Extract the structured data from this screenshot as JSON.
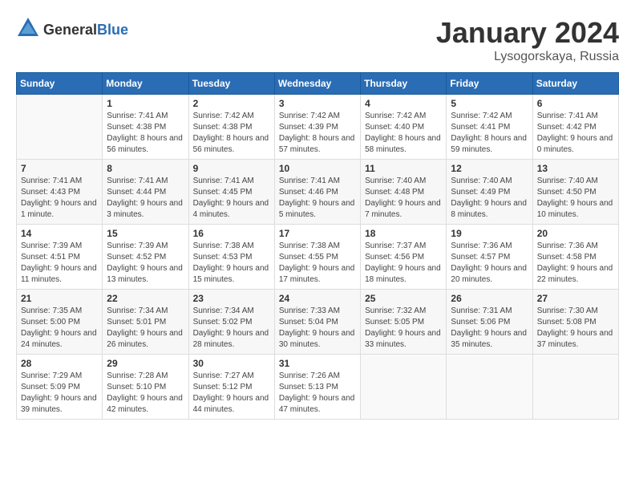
{
  "header": {
    "logo": {
      "general": "General",
      "blue": "Blue"
    },
    "month": "January 2024",
    "location": "Lysogorskaya, Russia"
  },
  "weekdays": [
    "Sunday",
    "Monday",
    "Tuesday",
    "Wednesday",
    "Thursday",
    "Friday",
    "Saturday"
  ],
  "weeks": [
    [
      {
        "day": "",
        "sunrise": "",
        "sunset": "",
        "daylight": ""
      },
      {
        "day": "1",
        "sunrise": "Sunrise: 7:41 AM",
        "sunset": "Sunset: 4:38 PM",
        "daylight": "Daylight: 8 hours and 56 minutes."
      },
      {
        "day": "2",
        "sunrise": "Sunrise: 7:42 AM",
        "sunset": "Sunset: 4:38 PM",
        "daylight": "Daylight: 8 hours and 56 minutes."
      },
      {
        "day": "3",
        "sunrise": "Sunrise: 7:42 AM",
        "sunset": "Sunset: 4:39 PM",
        "daylight": "Daylight: 8 hours and 57 minutes."
      },
      {
        "day": "4",
        "sunrise": "Sunrise: 7:42 AM",
        "sunset": "Sunset: 4:40 PM",
        "daylight": "Daylight: 8 hours and 58 minutes."
      },
      {
        "day": "5",
        "sunrise": "Sunrise: 7:42 AM",
        "sunset": "Sunset: 4:41 PM",
        "daylight": "Daylight: 8 hours and 59 minutes."
      },
      {
        "day": "6",
        "sunrise": "Sunrise: 7:41 AM",
        "sunset": "Sunset: 4:42 PM",
        "daylight": "Daylight: 9 hours and 0 minutes."
      }
    ],
    [
      {
        "day": "7",
        "sunrise": "Sunrise: 7:41 AM",
        "sunset": "Sunset: 4:43 PM",
        "daylight": "Daylight: 9 hours and 1 minute."
      },
      {
        "day": "8",
        "sunrise": "Sunrise: 7:41 AM",
        "sunset": "Sunset: 4:44 PM",
        "daylight": "Daylight: 9 hours and 3 minutes."
      },
      {
        "day": "9",
        "sunrise": "Sunrise: 7:41 AM",
        "sunset": "Sunset: 4:45 PM",
        "daylight": "Daylight: 9 hours and 4 minutes."
      },
      {
        "day": "10",
        "sunrise": "Sunrise: 7:41 AM",
        "sunset": "Sunset: 4:46 PM",
        "daylight": "Daylight: 9 hours and 5 minutes."
      },
      {
        "day": "11",
        "sunrise": "Sunrise: 7:40 AM",
        "sunset": "Sunset: 4:48 PM",
        "daylight": "Daylight: 9 hours and 7 minutes."
      },
      {
        "day": "12",
        "sunrise": "Sunrise: 7:40 AM",
        "sunset": "Sunset: 4:49 PM",
        "daylight": "Daylight: 9 hours and 8 minutes."
      },
      {
        "day": "13",
        "sunrise": "Sunrise: 7:40 AM",
        "sunset": "Sunset: 4:50 PM",
        "daylight": "Daylight: 9 hours and 10 minutes."
      }
    ],
    [
      {
        "day": "14",
        "sunrise": "Sunrise: 7:39 AM",
        "sunset": "Sunset: 4:51 PM",
        "daylight": "Daylight: 9 hours and 11 minutes."
      },
      {
        "day": "15",
        "sunrise": "Sunrise: 7:39 AM",
        "sunset": "Sunset: 4:52 PM",
        "daylight": "Daylight: 9 hours and 13 minutes."
      },
      {
        "day": "16",
        "sunrise": "Sunrise: 7:38 AM",
        "sunset": "Sunset: 4:53 PM",
        "daylight": "Daylight: 9 hours and 15 minutes."
      },
      {
        "day": "17",
        "sunrise": "Sunrise: 7:38 AM",
        "sunset": "Sunset: 4:55 PM",
        "daylight": "Daylight: 9 hours and 17 minutes."
      },
      {
        "day": "18",
        "sunrise": "Sunrise: 7:37 AM",
        "sunset": "Sunset: 4:56 PM",
        "daylight": "Daylight: 9 hours and 18 minutes."
      },
      {
        "day": "19",
        "sunrise": "Sunrise: 7:36 AM",
        "sunset": "Sunset: 4:57 PM",
        "daylight": "Daylight: 9 hours and 20 minutes."
      },
      {
        "day": "20",
        "sunrise": "Sunrise: 7:36 AM",
        "sunset": "Sunset: 4:58 PM",
        "daylight": "Daylight: 9 hours and 22 minutes."
      }
    ],
    [
      {
        "day": "21",
        "sunrise": "Sunrise: 7:35 AM",
        "sunset": "Sunset: 5:00 PM",
        "daylight": "Daylight: 9 hours and 24 minutes."
      },
      {
        "day": "22",
        "sunrise": "Sunrise: 7:34 AM",
        "sunset": "Sunset: 5:01 PM",
        "daylight": "Daylight: 9 hours and 26 minutes."
      },
      {
        "day": "23",
        "sunrise": "Sunrise: 7:34 AM",
        "sunset": "Sunset: 5:02 PM",
        "daylight": "Daylight: 9 hours and 28 minutes."
      },
      {
        "day": "24",
        "sunrise": "Sunrise: 7:33 AM",
        "sunset": "Sunset: 5:04 PM",
        "daylight": "Daylight: 9 hours and 30 minutes."
      },
      {
        "day": "25",
        "sunrise": "Sunrise: 7:32 AM",
        "sunset": "Sunset: 5:05 PM",
        "daylight": "Daylight: 9 hours and 33 minutes."
      },
      {
        "day": "26",
        "sunrise": "Sunrise: 7:31 AM",
        "sunset": "Sunset: 5:06 PM",
        "daylight": "Daylight: 9 hours and 35 minutes."
      },
      {
        "day": "27",
        "sunrise": "Sunrise: 7:30 AM",
        "sunset": "Sunset: 5:08 PM",
        "daylight": "Daylight: 9 hours and 37 minutes."
      }
    ],
    [
      {
        "day": "28",
        "sunrise": "Sunrise: 7:29 AM",
        "sunset": "Sunset: 5:09 PM",
        "daylight": "Daylight: 9 hours and 39 minutes."
      },
      {
        "day": "29",
        "sunrise": "Sunrise: 7:28 AM",
        "sunset": "Sunset: 5:10 PM",
        "daylight": "Daylight: 9 hours and 42 minutes."
      },
      {
        "day": "30",
        "sunrise": "Sunrise: 7:27 AM",
        "sunset": "Sunset: 5:12 PM",
        "daylight": "Daylight: 9 hours and 44 minutes."
      },
      {
        "day": "31",
        "sunrise": "Sunrise: 7:26 AM",
        "sunset": "Sunset: 5:13 PM",
        "daylight": "Daylight: 9 hours and 47 minutes."
      },
      {
        "day": "",
        "sunrise": "",
        "sunset": "",
        "daylight": ""
      },
      {
        "day": "",
        "sunrise": "",
        "sunset": "",
        "daylight": ""
      },
      {
        "day": "",
        "sunrise": "",
        "sunset": "",
        "daylight": ""
      }
    ]
  ]
}
